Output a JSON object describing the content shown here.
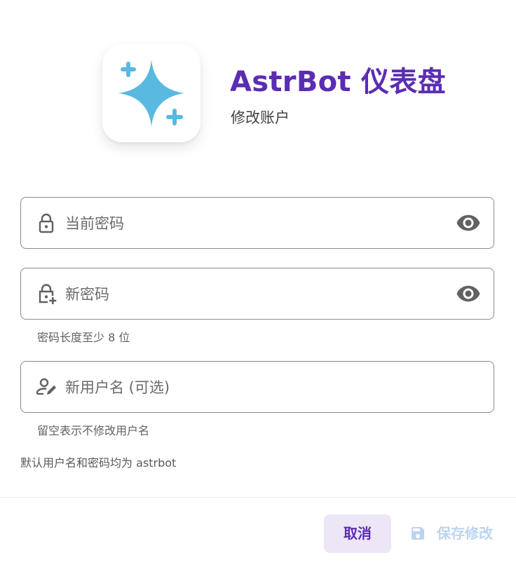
{
  "colors": {
    "brand": "#5b2db3",
    "sparkle": "#5ab9e0",
    "icon_gray": "#616161",
    "cancel_bg": "#ece6f7",
    "save_disabled": "#bcd4ef"
  },
  "header": {
    "logo_icon": "sparkle-icon",
    "title": "AstrBot 仪表盘",
    "subtitle": "修改账户"
  },
  "form": {
    "current_password": {
      "icon": "lock-icon",
      "label": "当前密码",
      "toggle_icon": "eye-icon"
    },
    "new_password": {
      "icon": "lock-plus-icon",
      "label": "新密码",
      "toggle_icon": "eye-icon",
      "hint": "密码长度至少 8 位"
    },
    "new_username": {
      "icon": "account-edit-icon",
      "label": "新用户名 (可选)",
      "hint": "留空表示不修改用户名"
    },
    "default_note": "默认用户名和密码均为 astrbot"
  },
  "actions": {
    "cancel_label": "取消",
    "save_label": "保存修改",
    "save_icon": "floppy-disk-icon",
    "save_enabled": false
  }
}
